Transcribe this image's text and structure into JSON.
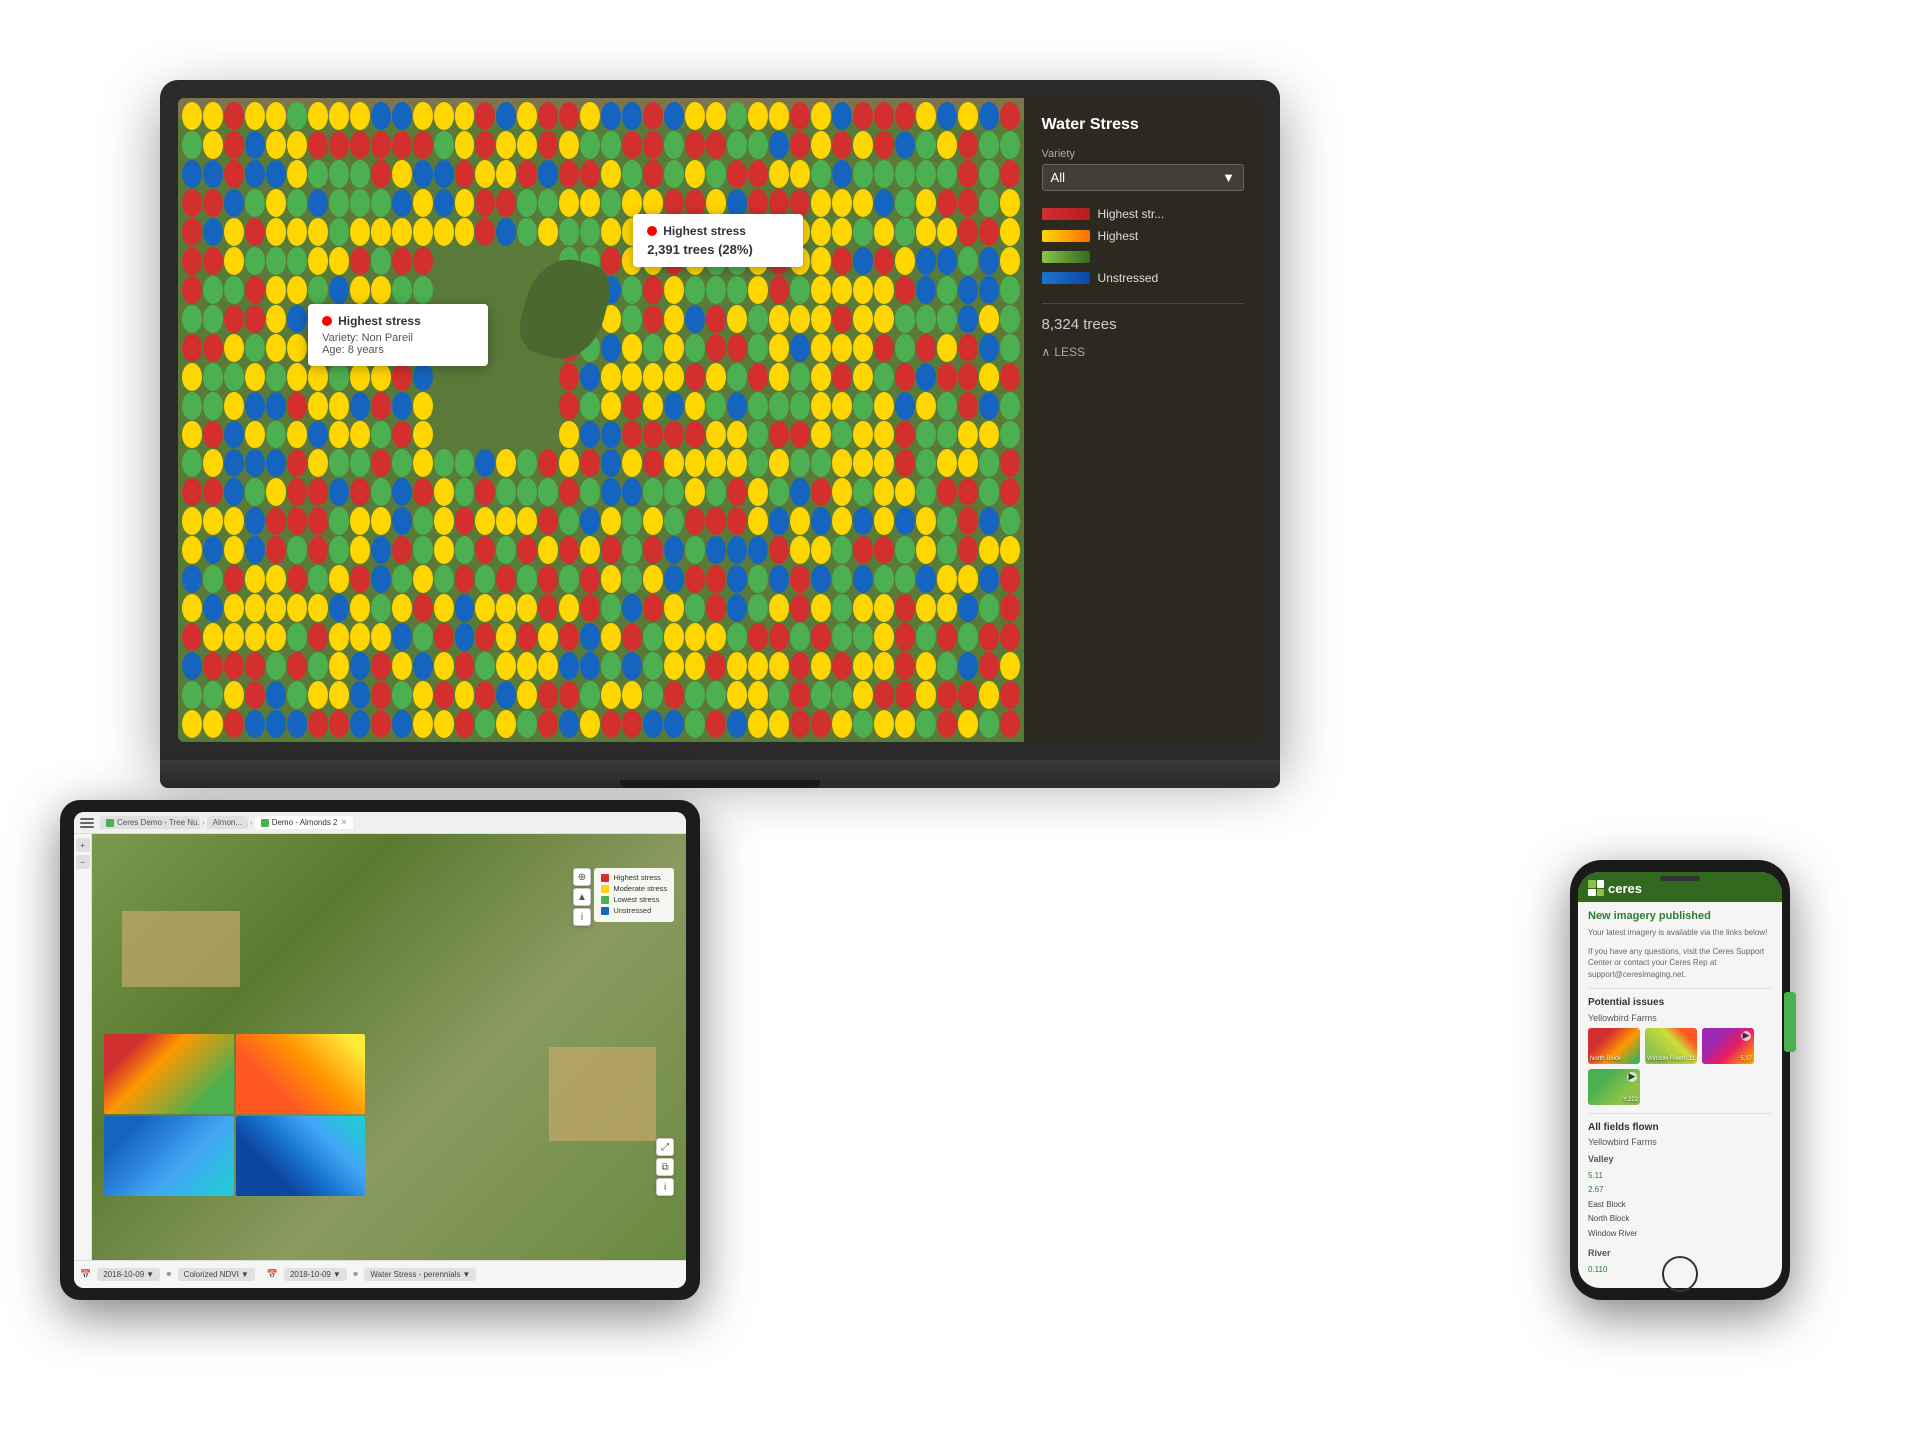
{
  "laptop": {
    "panel": {
      "title": "Water Stress",
      "variety_label": "Variety",
      "variety_value": "All",
      "legend": [
        {
          "color": "#d32f2f",
          "label": "Highest str..."
        },
        {
          "color": "#ffd600",
          "label": "Highest"
        },
        {
          "color": "#4caf50",
          "label": ""
        },
        {
          "color": "#1565c0",
          "label": "Unstressed"
        }
      ],
      "tree_count": "8,324 trees",
      "less_label": "LESS"
    },
    "tooltip_main": {
      "stress": "Highest stress",
      "variety": "Variety: Non Pareil",
      "age": "Age: 8 years"
    },
    "tooltip_secondary": {
      "stress": "Highest stress",
      "count": "2,391 trees (28%)"
    }
  },
  "tablet": {
    "browser": {
      "tabs": [
        {
          "label": "Ceres Demo - Tree Nu...",
          "active": false
        },
        {
          "label": "Almon...",
          "active": false
        },
        {
          "label": "Demo - Almonds 2",
          "active": true
        }
      ]
    },
    "legend": {
      "items": [
        {
          "color": "#d32f2f",
          "label": "Highest stress"
        },
        {
          "color": "#ffd600",
          "label": "Moderate stress"
        },
        {
          "color": "#4caf50",
          "label": "Lowest stress"
        },
        {
          "color": "#1565c0",
          "label": "Unstressed"
        }
      ]
    },
    "toolbar": {
      "date1": "2018-10-09",
      "date2": "2018-10-09",
      "map1": "Colorized NDVI",
      "map2": "Water Stress - perennials"
    }
  },
  "phone": {
    "header": {
      "logo_text": "ceres"
    },
    "notification": {
      "title": "New imagery published",
      "subtitle": "Your latest imagery is available via the links below!",
      "support_text": "If you have any questions, visit the Ceres Support Center or contact your Ceres Rep at support@ceresimaging.net."
    },
    "potential_issues": {
      "title": "Potential issues",
      "farm_label": "Yellowbird Farms",
      "fields": [
        {
          "name": "North Block",
          "score": ""
        },
        {
          "name": "Window River",
          "score": "0.11"
        },
        {
          "name": "",
          "score": "5.37"
        },
        {
          "name": "",
          "score": "Y.222"
        }
      ]
    },
    "all_fields": {
      "title": "All fields flown",
      "farm_label": "Yellowbird Farms",
      "categories": [
        {
          "label": "Valley",
          "fields": [
            "5.11",
            "",
            "2.67",
            "East Block",
            "North Block",
            "Window River"
          ]
        },
        {
          "label": "River",
          "fields": [
            "0.110"
          ]
        }
      ]
    }
  }
}
